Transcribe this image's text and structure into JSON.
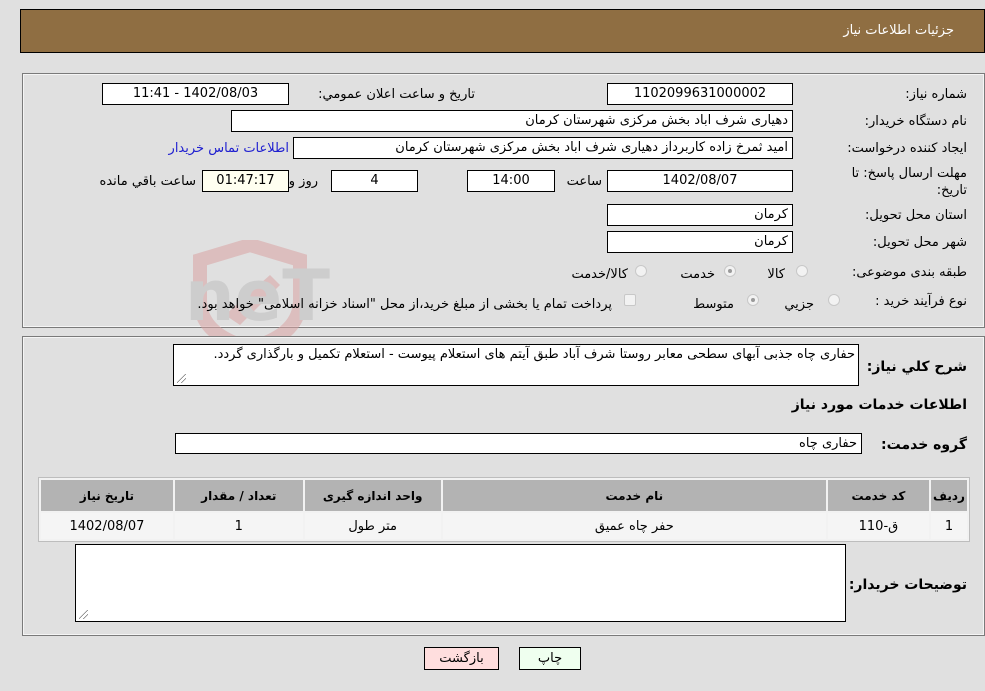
{
  "header": {
    "title": "جزئیات اطلاعات نیاز"
  },
  "form": {
    "need_number": {
      "label": "شماره نیاز:",
      "value": "1102099631000002"
    },
    "announce_datetime": {
      "label": "تاریخ و ساعت اعلان عمومي:",
      "value": "1402/08/03 - 11:41"
    },
    "buyer_org": {
      "label": "نام دستگاه خریدار:",
      "value": "دهیاری شرف اباد بخش مرکزی شهرستان کرمان"
    },
    "requester": {
      "label": "ایجاد کننده درخواست:",
      "value": "امید ثمرخ زاده کاربرداز دهیاری شرف اباد بخش مرکزی شهرستان کرمان"
    },
    "buyer_contact_link": "اطلاعات تماس خریدار",
    "deadline": {
      "label_line1": "مهلت ارسال پاسخ: تا",
      "label_line2": "تاریخ:",
      "date": "1402/08/07",
      "time_label": "ساعت",
      "time": "14:00",
      "days": "4",
      "days_label": "روز و",
      "remaining": "01:47:17",
      "remaining_label": "ساعت باقي مانده"
    },
    "province": {
      "label": "استان محل تحویل:",
      "value": "کرمان"
    },
    "city": {
      "label": "شهر محل تحویل:",
      "value": "کرمان"
    },
    "category": {
      "label": "طبقه بندی موضوعی:",
      "options": [
        "کالا",
        "خدمت",
        "کالا/خدمت"
      ],
      "selected": "خدمت"
    },
    "purchase_type": {
      "label": "نوع فرآیند خرید :",
      "options": [
        "جزيي",
        "متوسط"
      ],
      "selected": "متوسط",
      "treasury_note": "پرداخت تمام یا بخشی از مبلغ خرید،از محل \"اسناد خزانه اسلامی\" خواهد بود."
    }
  },
  "description": {
    "label": "شرح کلي نياز:",
    "value": "حفاری چاه جذبی آبهای سطحی معابر روستا شرف آباد طبق آیتم های استعلام پیوست -  استعلام تکمیل و بارگذاری گردد."
  },
  "services_section": {
    "title": "اطلاعات خدمات مورد نیاز",
    "group_label": "گروه خدمت:",
    "group_value": "حفاری چاه"
  },
  "table": {
    "headers": [
      "ردیف",
      "کد خدمت",
      "نام خدمت",
      "واحد اندازه گیری",
      "تعداد / مقدار",
      "تاریخ نیاز"
    ],
    "rows": [
      [
        "1",
        "ق-110",
        "حفر چاه عمیق",
        "متر طول",
        "1",
        "1402/08/07"
      ]
    ]
  },
  "buyer_notes": {
    "label": "توضیحات خریدار:",
    "value": ""
  },
  "buttons": {
    "print": "چاپ",
    "back": "بازگشت"
  },
  "colors": {
    "header_bg": "#8f6e42",
    "print_bg": "#efffef",
    "back_bg": "#ffdede",
    "link": "#2020d0"
  },
  "watermark": "AriaTender.neT"
}
